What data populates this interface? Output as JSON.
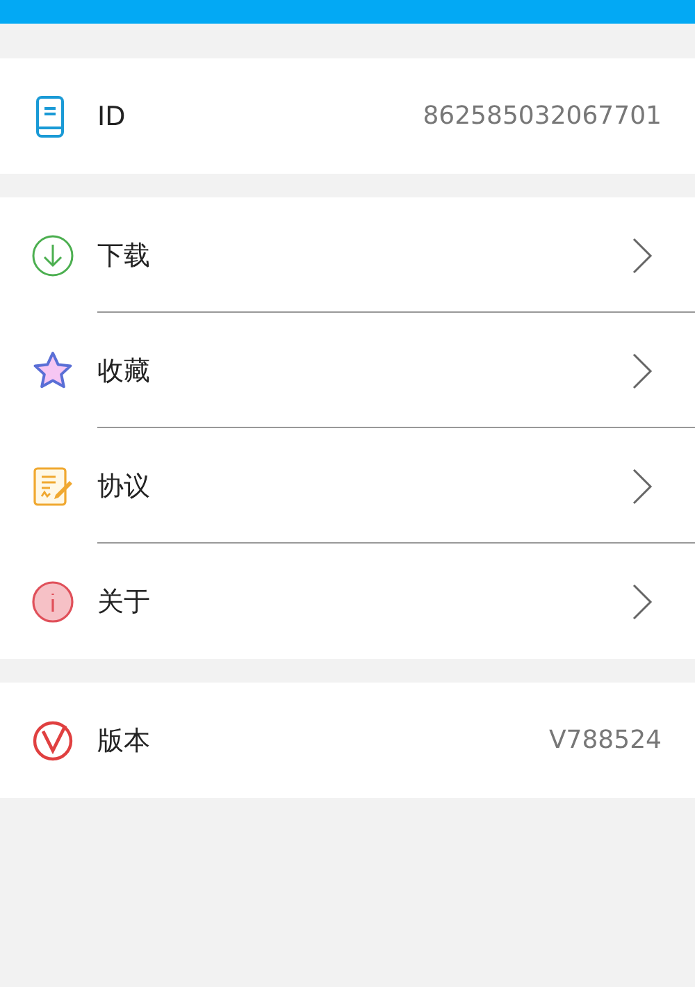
{
  "sections": [
    {
      "rows": [
        {
          "label": "ID",
          "value": "862585032067701"
        }
      ]
    },
    {
      "rows": [
        {
          "label": "下载",
          "chevron": true
        },
        {
          "label": "收藏",
          "chevron": true
        },
        {
          "label": "协议",
          "chevron": true
        },
        {
          "label": "关于",
          "chevron": true
        }
      ]
    },
    {
      "rows": [
        {
          "label": "版本",
          "value": "V788524"
        }
      ]
    }
  ]
}
